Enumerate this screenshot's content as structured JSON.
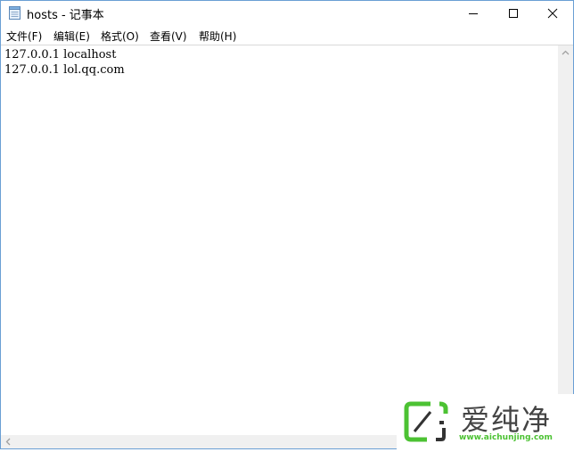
{
  "window": {
    "title": "hosts - 记事本",
    "icon": "notepad-icon",
    "controls": {
      "minimize": "minimize-icon",
      "maximize": "maximize-icon",
      "close": "close-icon"
    }
  },
  "menu": {
    "items": [
      {
        "label": "文件(F)"
      },
      {
        "label": "编辑(E)"
      },
      {
        "label": "格式(O)"
      },
      {
        "label": "查看(V)"
      },
      {
        "label": "帮助(H)"
      }
    ]
  },
  "editor": {
    "lines": [
      "127.0.0.1 localhost",
      "127.0.0.1 lol.qq.com"
    ]
  },
  "watermark": {
    "brand": "爱纯净",
    "url": "www.aichunjing.com",
    "accent_color": "#4cc233"
  }
}
